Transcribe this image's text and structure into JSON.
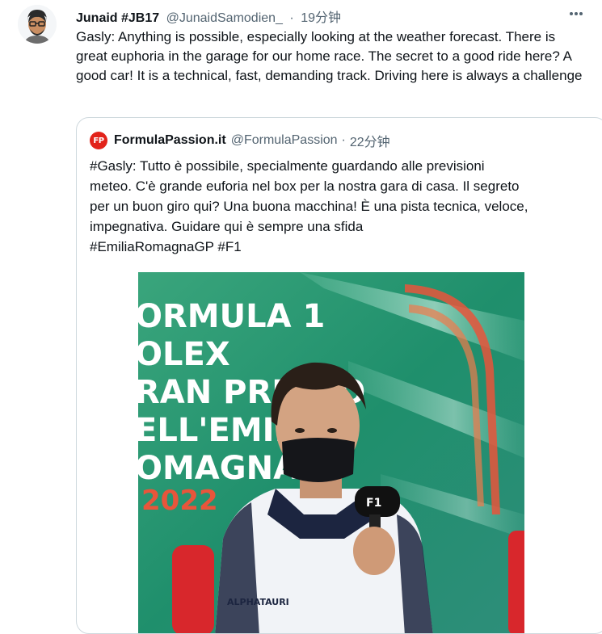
{
  "tweet": {
    "author_name": "Junaid #JB17",
    "handle": "@JunaidSamodien_",
    "separator": "·",
    "time": "19分钟",
    "text": "Gasly: Anything is possible, especially looking at the weather forecast. There is great euphoria in the garage for our home race. The secret to a good ride here? A good car! It is a technical, fast, demanding track. Driving here is always a challenge"
  },
  "quote": {
    "logo_text": "FP",
    "author_name": "FormulaPassion.it",
    "handle": "@FormulaPassion",
    "separator": "·",
    "time": "22分钟",
    "text_lines": [
      "#Gasly: Tutto è possibile, specialmente guardando alle previsioni",
      "meteo. C'è grande euforia nel box per la nostra gara di casa. Il segreto",
      "per un buon giro qui? Una buona macchina! È una pista tecnica, veloce,",
      "impegnativa. Guidare qui è sempre una sfida",
      "#EmiliaRomagnaGP #F1"
    ],
    "image": {
      "backdrop_lines": [
        "ORMULA 1",
        "OLEX",
        "RAN PREMIO",
        "ELL'EMILIA",
        "OMAGNA",
        "2022"
      ],
      "mic_label": "F1",
      "jacket_logo": "ALPHATAURI"
    }
  },
  "colors": {
    "text": "#0f1419",
    "secondary": "#536471",
    "border": "#cfd9de",
    "logo_red": "#e2231a",
    "backdrop_green": "#2f9a72"
  }
}
